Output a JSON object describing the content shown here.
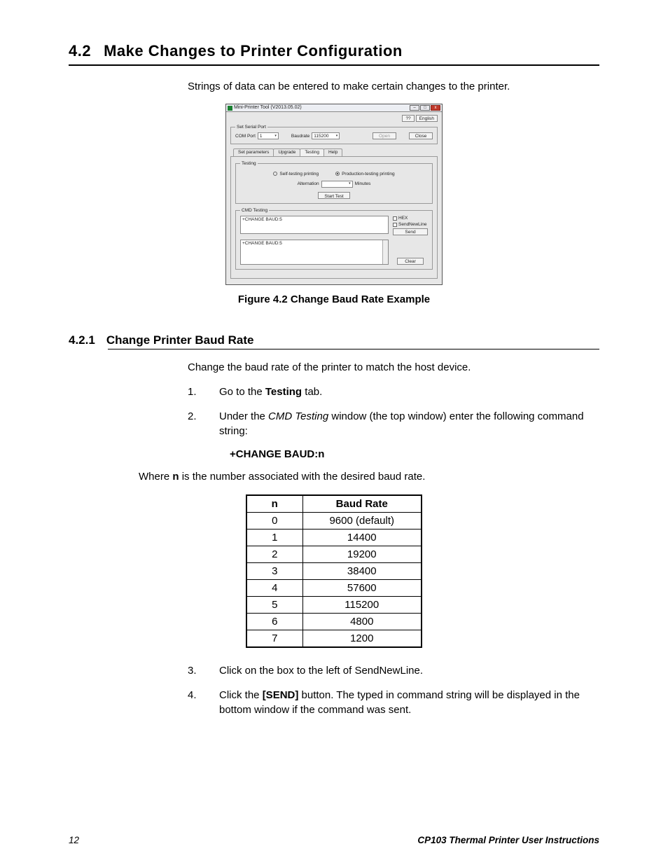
{
  "section": {
    "num": "4.2",
    "title": "Make Changes to Printer Configuration"
  },
  "intro": "Strings of data can be entered to make certain changes to the printer.",
  "app": {
    "title": "Mini-Printer Tool (V2013.05.02)",
    "lang_q": "??",
    "lang_en": "English",
    "serial_legend": "Set Serial Port",
    "com_label": "COM Port",
    "com_value": "1",
    "baud_label": "Baudrate",
    "baud_value": "115200",
    "open": "Open",
    "close": "Close",
    "tabs": {
      "t0": "Set parameters",
      "t1": "Upgrade",
      "t2": "Testing",
      "t3": "Help"
    },
    "testing_legend": "Testing",
    "radio_self": "Self-testing printing",
    "radio_prod": "Production-testing printing",
    "alt_label": "Alternation",
    "minutes": "Minutes",
    "start_test": "Start Test",
    "cmd_legend": "CMD Testing",
    "cmd_input": "+CHANGE BAUD:5",
    "hex": "HEX",
    "sendnewline": "SendNewLine",
    "send": "Send",
    "cmd_output": "+CHANGE BAUD:5",
    "clear": "Clear"
  },
  "figcap": "Figure 4.2  Change Baud Rate Example",
  "subsection": {
    "num": "4.2.1",
    "title": "Change Printer Baud Rate"
  },
  "sub_intro": "Change the baud rate of the printer to match the host device.",
  "steps": {
    "s1_a": "Go to the ",
    "s1_b": "Testing",
    "s1_c": " tab.",
    "s2_a": "Under the ",
    "s2_b": "CMD Testing",
    "s2_c": " window (the top window) enter the following command string:",
    "cmd": "+CHANGE BAUD:n",
    "where_a": "Where ",
    "where_b": "n",
    "where_c": " is the number associated with the desired baud rate.",
    "s3": "Click on the box to the left of SendNewLine.",
    "s4_a": "Click the ",
    "s4_b": "[SEND]",
    "s4_c": " button. The typed in command string will be displayed in the bottom window if the command was sent."
  },
  "table": {
    "h_n": "n",
    "h_b": "Baud Rate",
    "r0n": "0",
    "r0b": "9600 (default)",
    "r1n": "1",
    "r1b": "14400",
    "r2n": "2",
    "r2b": "19200",
    "r3n": "3",
    "r3b": "38400",
    "r4n": "4",
    "r4b": "57600",
    "r5n": "5",
    "r5b": "115200",
    "r6n": "6",
    "r6b": "4800",
    "r7n": "7",
    "r7b": "1200"
  },
  "footer": {
    "page": "12",
    "doc": "CP103 Thermal Printer User Instructions"
  }
}
